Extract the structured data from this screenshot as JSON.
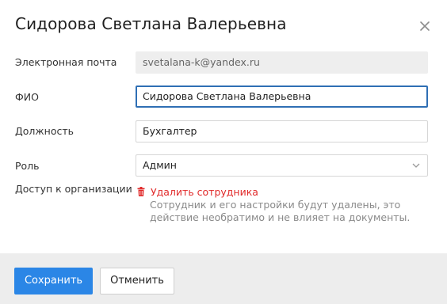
{
  "dialog": {
    "title": "Сидорова Светлана Валерьевна",
    "close_icon": "close-icon"
  },
  "fields": {
    "email": {
      "label": "Электронная почта",
      "value": "svetalana-k@yandex.ru"
    },
    "fio": {
      "label": "ФИО",
      "value": "Сидорова Светлана Валерьевна"
    },
    "position": {
      "label": "Должность",
      "value": "Бухгалтер"
    },
    "role": {
      "label": "Роль",
      "value": "Админ"
    },
    "access": {
      "label": "Доступ к организации"
    }
  },
  "delete": {
    "icon": "trash-icon",
    "label": "Удалить сотрудника",
    "note": "Сотрудник и его настройки будут удалены, это действие необратимо и не влияет на документы."
  },
  "footer": {
    "save_label": "Сохранить",
    "cancel_label": "Отменить"
  },
  "colors": {
    "primary": "#2b86e6",
    "danger": "#e12a2a",
    "focus_border": "#2f6fb4",
    "footer_bg": "#ededed"
  }
}
